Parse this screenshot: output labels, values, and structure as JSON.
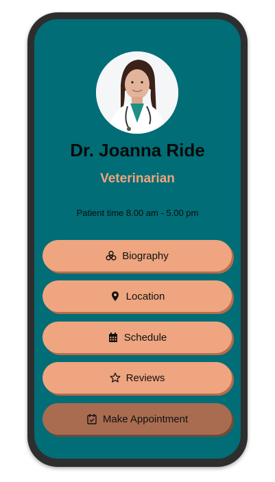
{
  "profile": {
    "name": "Dr. Joanna Ride",
    "title": "Veterinarian",
    "hours": "Patient time 8.00 am - 5.00 pm"
  },
  "buttons": {
    "biography": {
      "label": "Biography",
      "icon": "biohazard-icon"
    },
    "location": {
      "label": "Location",
      "icon": "map-pin-icon"
    },
    "schedule": {
      "label": "Schedule",
      "icon": "calendar-icon"
    },
    "reviews": {
      "label": "Reviews",
      "icon": "star-icon"
    },
    "appointment": {
      "label": "Make Appointment",
      "icon": "calendar-check-icon"
    }
  },
  "colors": {
    "screen_background": "#006d77",
    "accent": "#f2a47e",
    "button": "#eea580",
    "primary_button": "#a96c50"
  }
}
